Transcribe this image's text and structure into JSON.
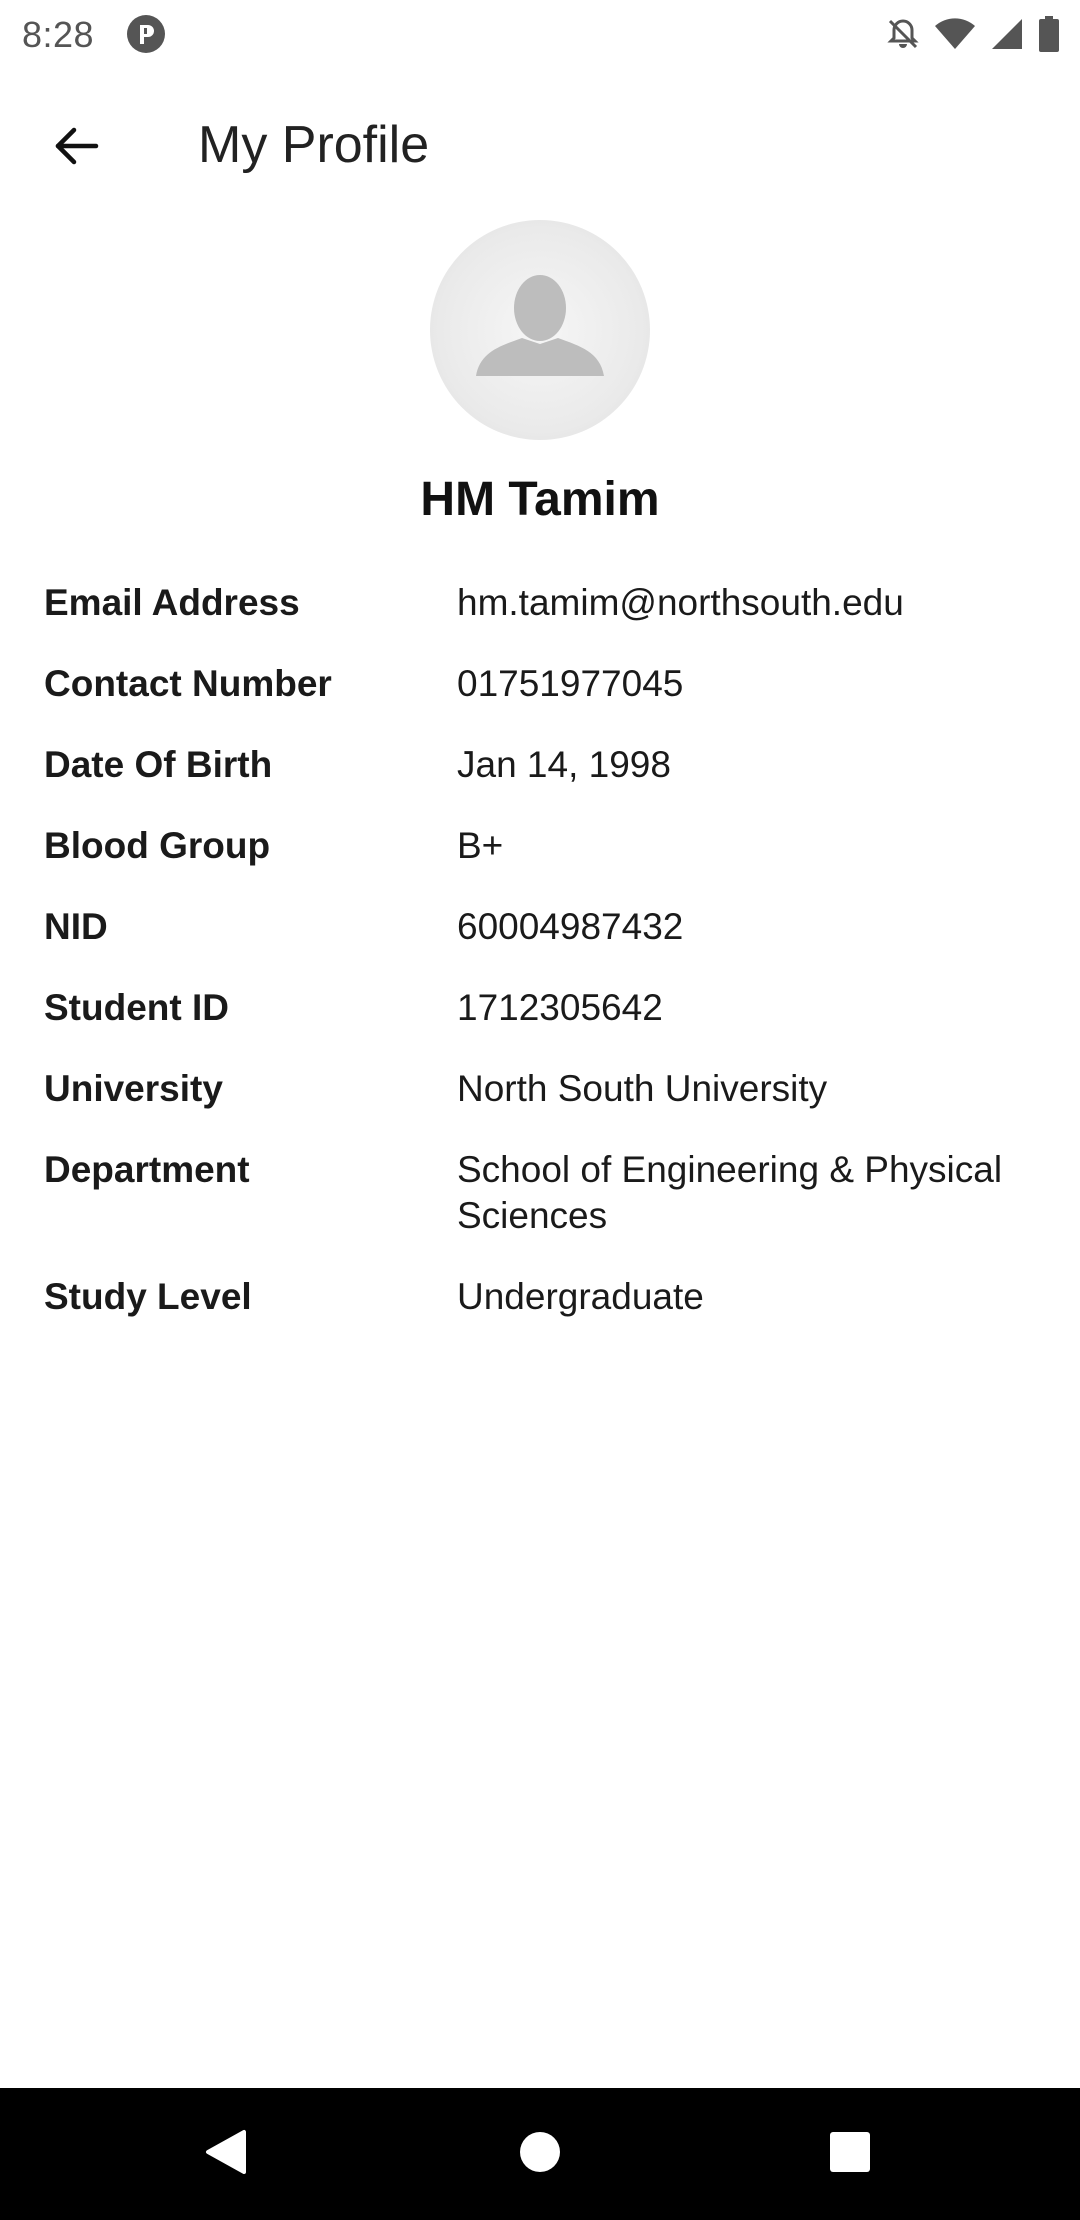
{
  "status_bar": {
    "time": "8:28",
    "icons": [
      "app-notification-icon",
      "notifications-off-icon",
      "wifi-icon",
      "signal-icon",
      "battery-icon"
    ]
  },
  "header": {
    "title": "My Profile",
    "back_icon": "arrow-left-icon"
  },
  "profile": {
    "avatar_icon": "person-silhouette-icon",
    "name": "HM Tamim",
    "fields": [
      {
        "label": "Email Address",
        "value": "hm.tamim@northsouth.edu"
      },
      {
        "label": "Contact Number",
        "value": "01751977045"
      },
      {
        "label": "Date Of Birth",
        "value": "Jan 14, 1998"
      },
      {
        "label": "Blood Group",
        "value": "B+"
      },
      {
        "label": "NID",
        "value": "60004987432"
      },
      {
        "label": "Student ID",
        "value": "1712305642"
      },
      {
        "label": "University",
        "value": "North South University"
      },
      {
        "label": "Department",
        "value": "School of Engineering & Physical Sciences"
      },
      {
        "label": "Study Level",
        "value": "Undergraduate"
      }
    ]
  },
  "nav_bar": {
    "buttons": [
      "back-triangle-icon",
      "home-circle-icon",
      "recents-square-icon"
    ]
  },
  "colors": {
    "background": "#ffffff",
    "text": "#111111",
    "avatar_bg": "#eaeaea",
    "avatar_figure": "#bdbdbd",
    "nav_bar": "#000000",
    "nav_icons": "#ffffff"
  }
}
